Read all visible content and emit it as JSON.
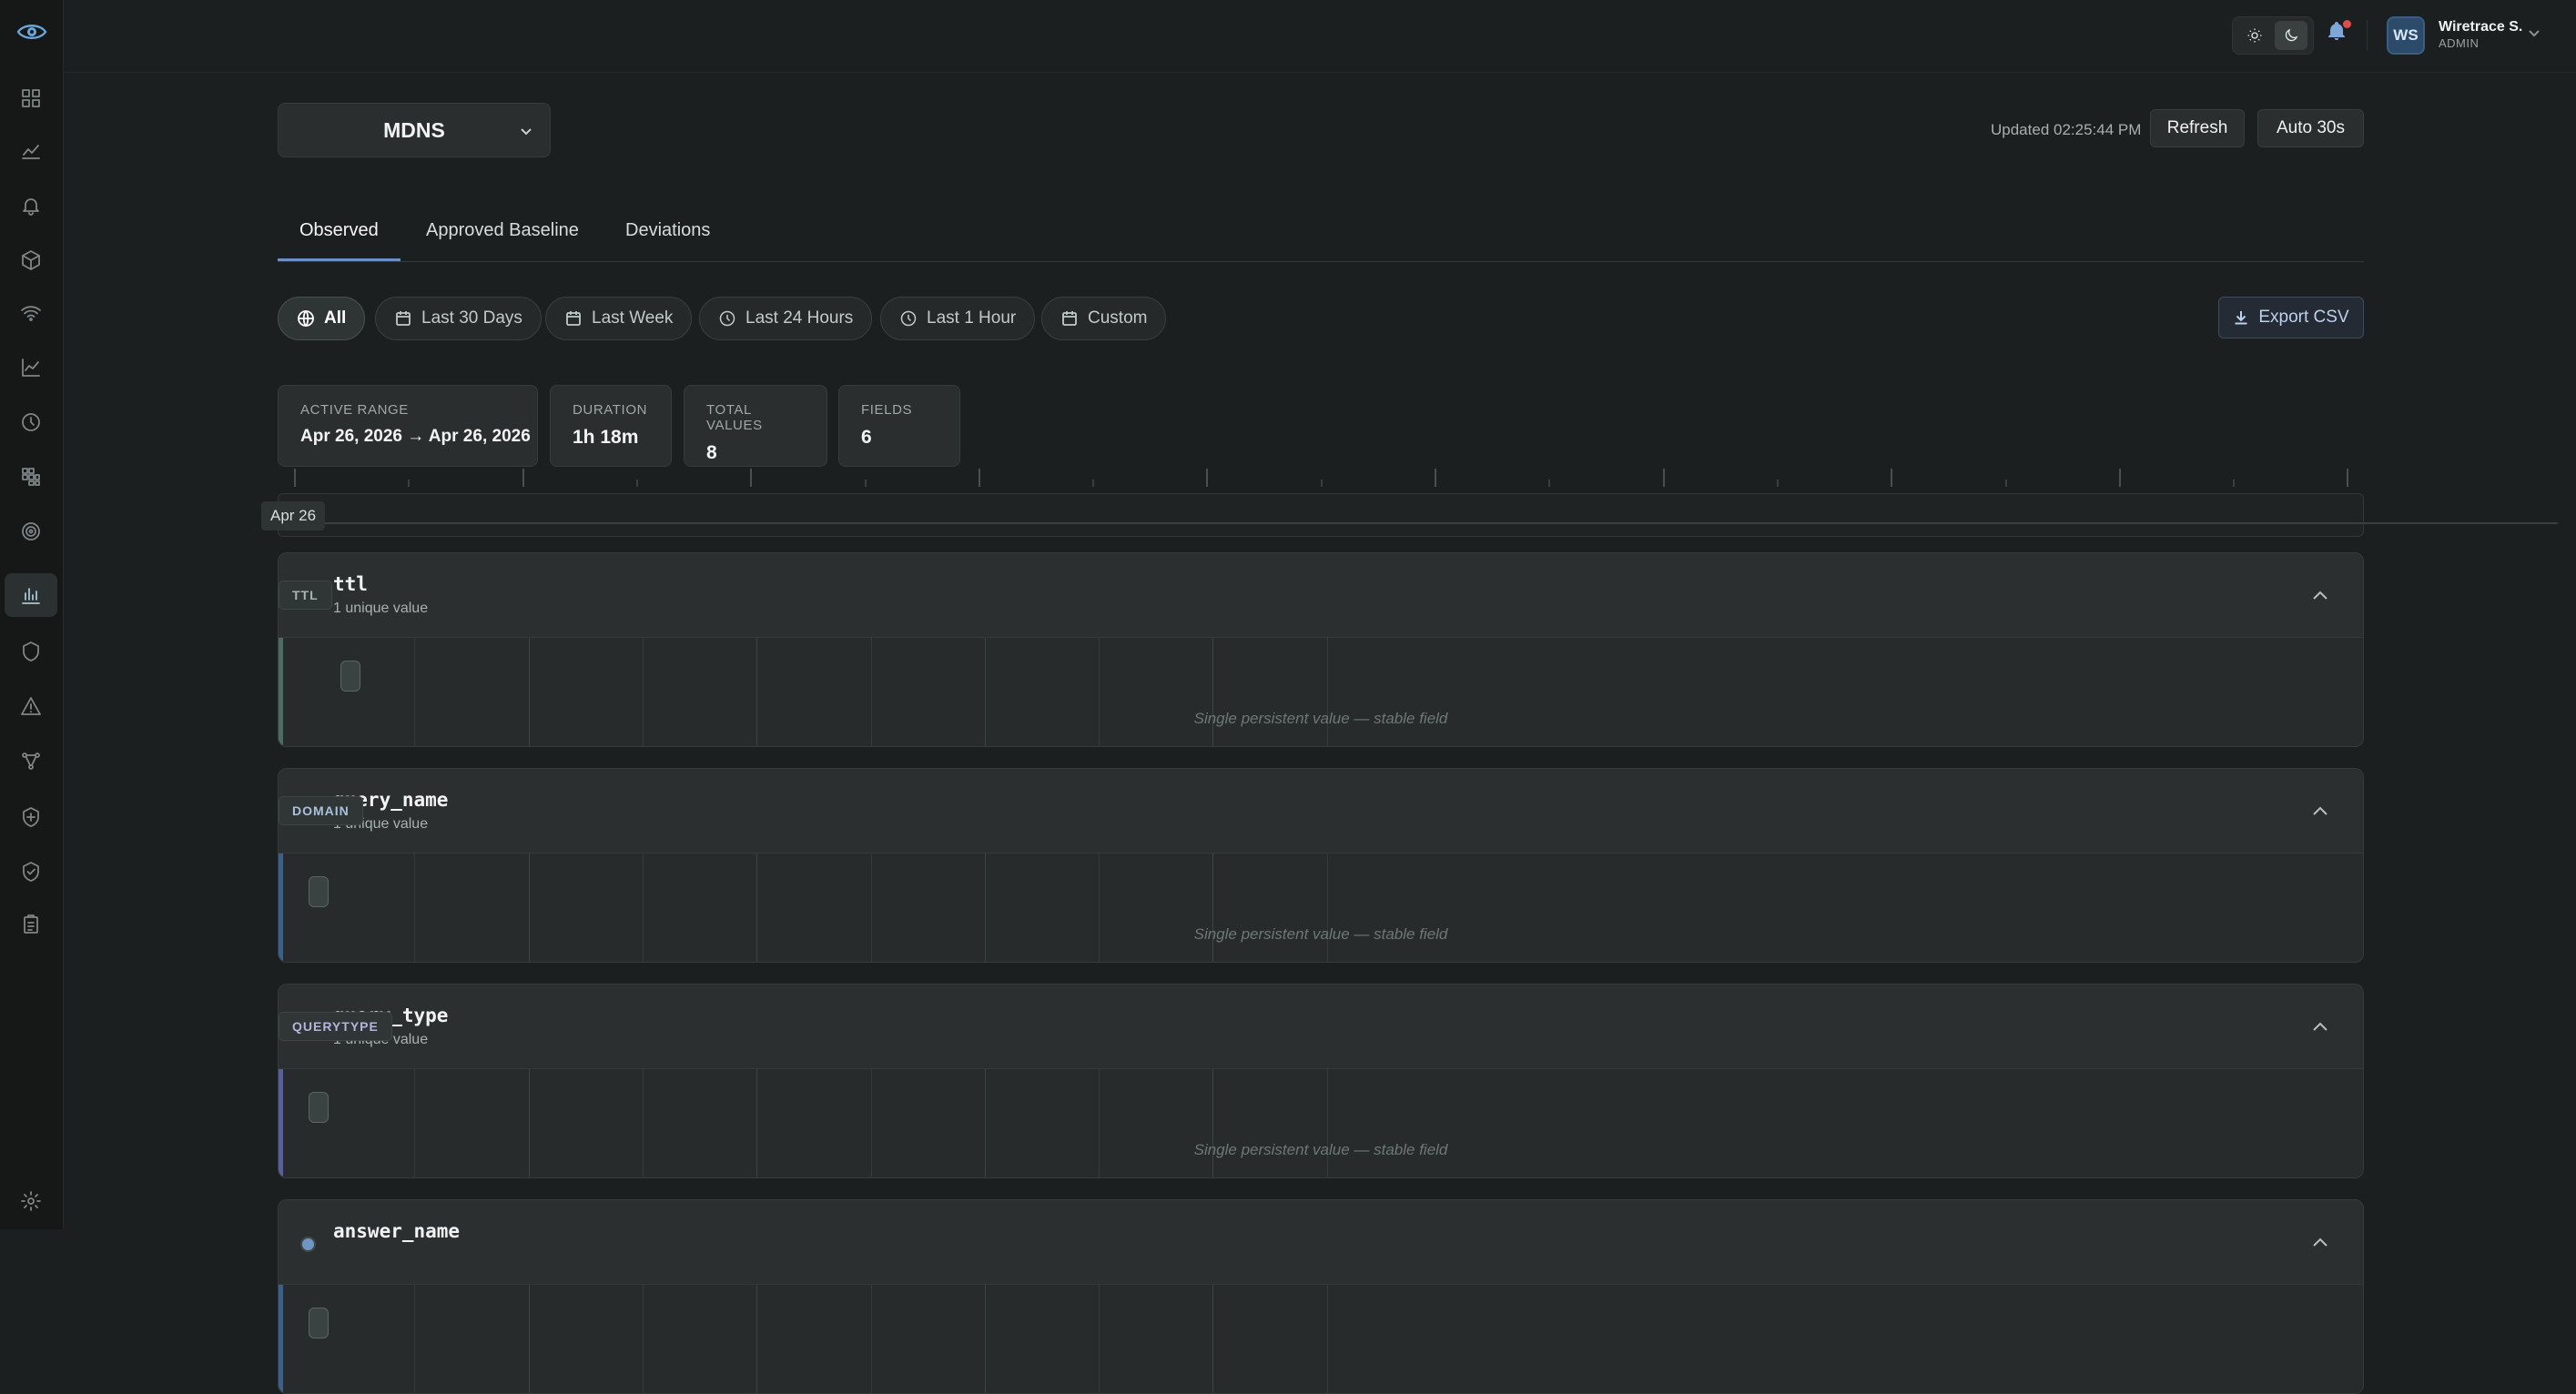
{
  "colors": {
    "accent": "#6d8fc4",
    "bg": "#1c1f1f",
    "card": "#252929",
    "notification_dot": "#e04c4c"
  },
  "sidebar": {
    "logo_icon": "eye-logo-icon",
    "items": [
      {
        "icon": "grid-icon"
      },
      {
        "icon": "line-chart-icon"
      },
      {
        "icon": "bell-icon"
      },
      {
        "icon": "cube-icon"
      },
      {
        "icon": "wifi-icon"
      },
      {
        "icon": "trend-icon"
      },
      {
        "icon": "clock-icon"
      },
      {
        "icon": "heatmap-icon"
      },
      {
        "icon": "radar-icon"
      },
      {
        "icon": "bar-chart-icon",
        "active": true
      },
      {
        "icon": "shield-icon"
      },
      {
        "icon": "warning-icon"
      },
      {
        "icon": "graph-icon"
      },
      {
        "icon": "shield-plus-icon"
      },
      {
        "icon": "shield-check-icon"
      },
      {
        "icon": "clipboard-icon"
      }
    ],
    "settings_icon": "gear-icon"
  },
  "topbar": {
    "theme": {
      "light_icon": "sun-icon",
      "dark_icon": "moon-icon",
      "selected": "dark"
    },
    "notifications_icon": "bell-icon",
    "user": {
      "initials": "WS",
      "name": "Wiretrace S.",
      "role": "ADMIN"
    }
  },
  "header": {
    "protocol": "MDNS",
    "updated": "Updated 02:25:44 PM",
    "refresh_label": "Refresh",
    "auto_label": "Auto 30s"
  },
  "tabs": [
    {
      "label": "Observed",
      "active": true
    },
    {
      "label": "Approved Baseline",
      "active": false
    },
    {
      "label": "Deviations",
      "active": false
    }
  ],
  "filters": [
    {
      "label": "All",
      "icon": "globe-icon",
      "active": true
    },
    {
      "label": "Last 30 Days",
      "icon": "calendar-icon"
    },
    {
      "label": "Last Week",
      "icon": "calendar-icon"
    },
    {
      "label": "Last 24 Hours",
      "icon": "clock-icon"
    },
    {
      "label": "Last 1 Hour",
      "icon": "clock-icon"
    },
    {
      "label": "Custom",
      "icon": "calendar-icon"
    }
  ],
  "export_label": "Export CSV",
  "stats": [
    {
      "label": "ACTIVE RANGE",
      "value": "Apr 26, 2026 → Apr 26, 2026"
    },
    {
      "label": "DURATION",
      "value": "1h 18m"
    },
    {
      "label": "TOTAL VALUES",
      "value": "8"
    },
    {
      "label": "FIELDS",
      "value": "6"
    }
  ],
  "timeline": {
    "start_label": "Apr 26"
  },
  "fields": [
    {
      "name": "ttl",
      "sub": "1 unique value",
      "badge": "TTL",
      "badge_color": "#a9b3b3",
      "accent": "#4f6a62",
      "dot": "#8ea3a8",
      "note": "Single persistent value — stable field"
    },
    {
      "name": "query_name",
      "sub": "1 unique value",
      "badge": "DOMAIN",
      "badge_color": "#a9c1dc",
      "accent": "#3f5f86",
      "dot": "#6f95c4",
      "note": "Single persistent value — stable field"
    },
    {
      "name": "query_type",
      "sub": "1 unique value",
      "badge": "QUERYTYPE",
      "badge_color": "#b4b4dc",
      "accent": "#5a5f96",
      "dot": "#8a8fd2",
      "note": "Single persistent value — stable field"
    },
    {
      "name": "answer_name",
      "sub": "",
      "badge": "",
      "badge_color": "#a9c1dc",
      "accent": "#3f5f86",
      "dot": "#6f95c4",
      "note": ""
    }
  ]
}
